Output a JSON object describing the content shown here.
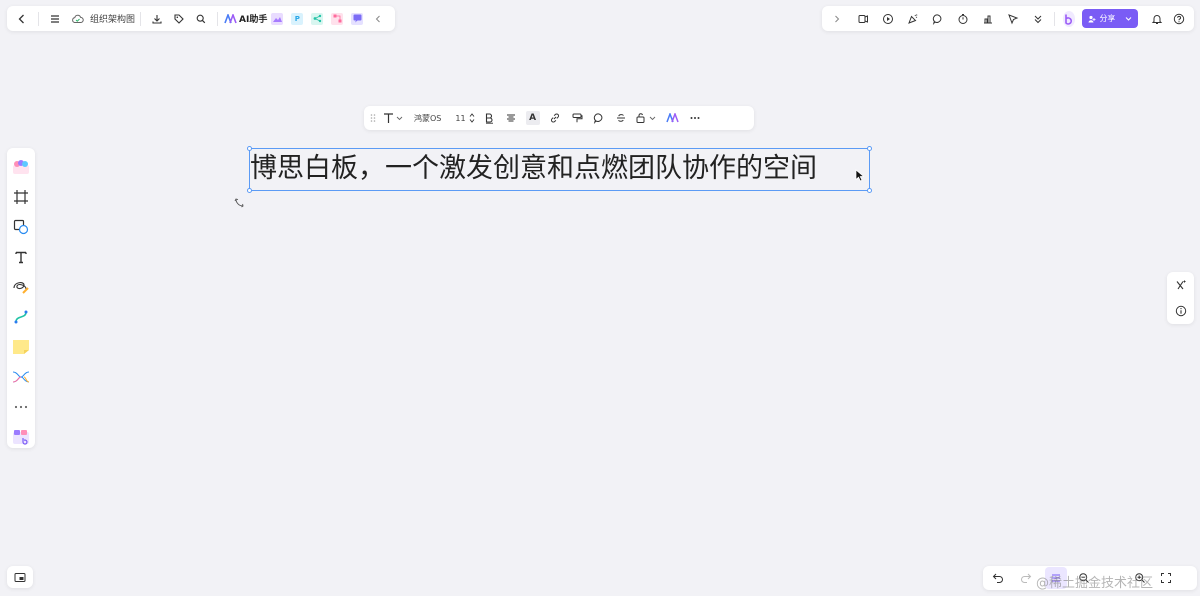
{
  "top_left_toolbar": {
    "doc_title": "组织架构图",
    "ai_label": "AI助手",
    "apps": [
      {
        "name": "image-app",
        "color": "#c8a8ff",
        "glyph": ""
      },
      {
        "name": "p-app",
        "color": "#4ec8f4",
        "glyph": "P"
      },
      {
        "name": "mindmap-app",
        "color": "#2cc9b0",
        "glyph": ""
      },
      {
        "name": "flow-app",
        "color": "#ff7aa8",
        "glyph": ""
      },
      {
        "name": "comment-app",
        "color": "#7b6cf6",
        "glyph": ""
      }
    ]
  },
  "top_right_toolbar": {
    "share_label": "分享"
  },
  "format_toolbar": {
    "font_name": "鸿蒙OS",
    "font_size": "11"
  },
  "canvas": {
    "text": "博思白板，一个激发创意和点燃团队协作的空间"
  },
  "watermark": "@稀土掘金技术社区",
  "colors": {
    "accent": "#7a5cf5",
    "selection": "#5b9bf5",
    "background": "#f2f2f6"
  }
}
